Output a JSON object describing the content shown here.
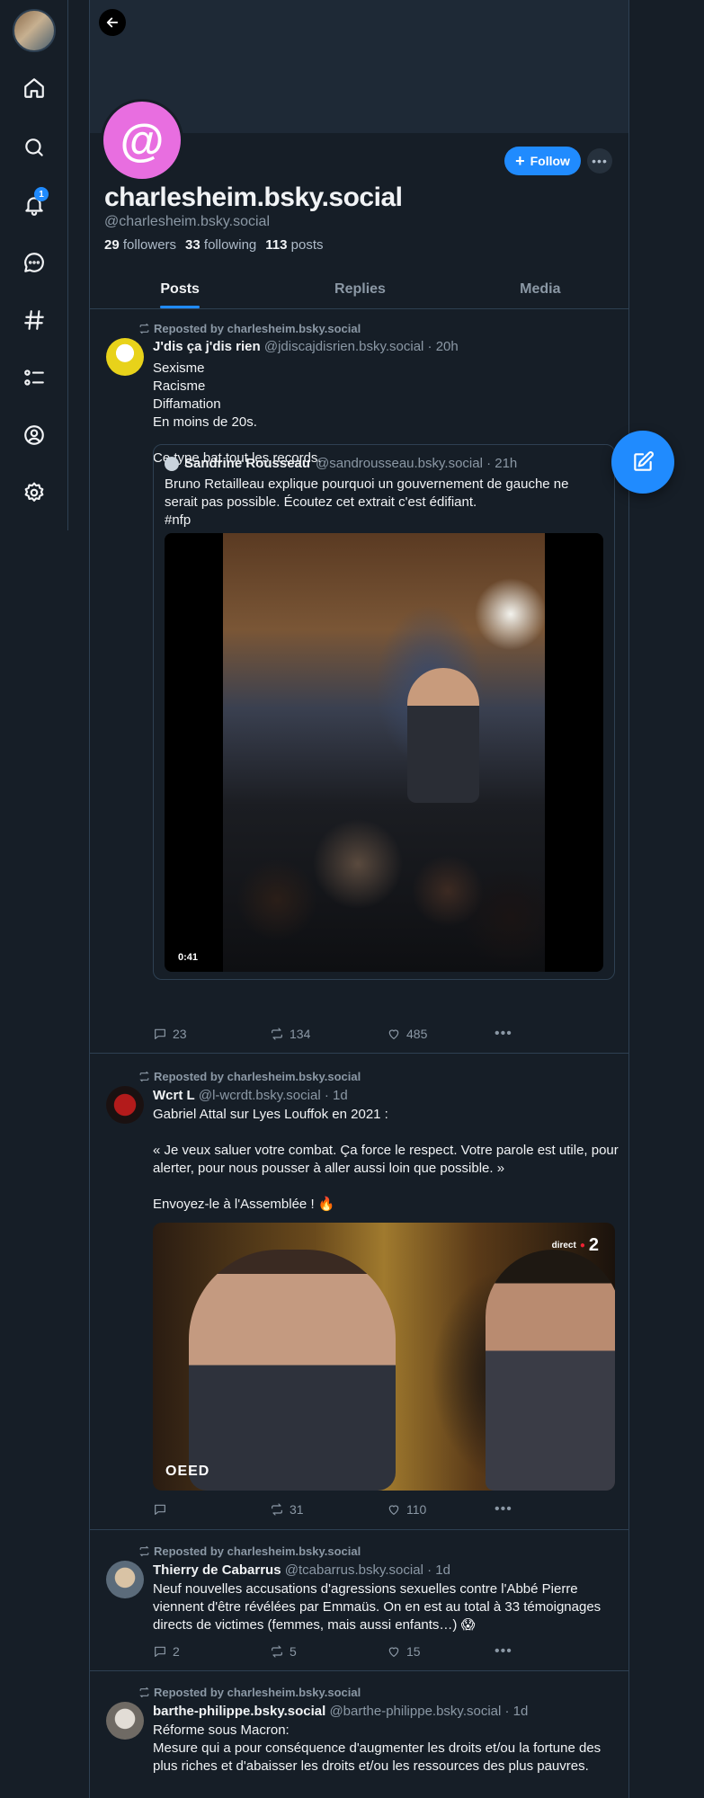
{
  "rail": {
    "notification_count": "1",
    "items": [
      {
        "name": "home-icon"
      },
      {
        "name": "search-icon"
      },
      {
        "name": "bell-icon"
      },
      {
        "name": "chat-icon"
      },
      {
        "name": "hashtag-icon"
      },
      {
        "name": "lists-icon"
      },
      {
        "name": "profile-icon"
      },
      {
        "name": "settings-icon"
      }
    ]
  },
  "profile": {
    "avatar_symbol": "@",
    "display_name": "charlesheim.bsky.social",
    "handle": "@charlesheim.bsky.social",
    "followers_count": "29",
    "followers_label": "followers",
    "following_count": "33",
    "following_label": "following",
    "posts_count": "113",
    "posts_label": "posts",
    "follow_label": "Follow"
  },
  "tabs": [
    {
      "label": "Posts",
      "active": true
    },
    {
      "label": "Replies",
      "active": false
    },
    {
      "label": "Media",
      "active": false
    }
  ],
  "posts": [
    {
      "repost_label": "Reposted by charlesheim.bsky.social",
      "author": "J'dis ça j'dis rien",
      "meta": "@jdiscajdisrien.bsky.social · 20h",
      "text": "Sexisme\nRacisme\nDiffamation\nEn moins de 20s.\n\nCe type bat tout les records.",
      "quote": {
        "author": "Sandrine Rousseau",
        "meta": "@sandrousseau.bsky.social · 21h",
        "text": "Bruno Retailleau explique pourquoi un gouvernement de gauche ne serait pas possible. Écoutez cet extrait c'est édifiant.\n#nfp",
        "video_duration": "0:41"
      },
      "replies": "23",
      "reposts": "134",
      "likes": "485"
    },
    {
      "repost_label": "Reposted by charlesheim.bsky.social",
      "author": "Wcrt L",
      "meta": "@l-wcrdt.bsky.social · 1d",
      "text": "Gabriel Attal sur Lyes Louffok en 2021 :\n\n« Je veux saluer votre combat. Ça force le respect. Votre parole est utile, pour alerter, pour nous pousser à aller aussi loin que possible. »\n\nEnvoyez-le à l'Assemblée ! 🔥",
      "tv_logo_prefix": "direct",
      "tv_logo": "2",
      "tv_watermark": "OEED",
      "replies": "",
      "reposts": "31",
      "likes": "110"
    },
    {
      "repost_label": "Reposted by charlesheim.bsky.social",
      "author": "Thierry de Cabarrus",
      "meta": "@tcabarrus.bsky.social · 1d",
      "text": "Neuf nouvelles accusations d'agressions sexuelles contre l'Abbé Pierre viennent d'être révélées par Emmaüs. On en est au total à 33 témoignages directs de victimes (femmes, mais aussi enfants…) 😱",
      "replies": "2",
      "reposts": "5",
      "likes": "15"
    },
    {
      "repost_label": "Reposted by charlesheim.bsky.social",
      "author": "barthe-philippe.bsky.social",
      "meta": "@barthe-philippe.bsky.social · 1d",
      "text": "Réforme sous Macron:\nMesure qui a pour conséquence d'augmenter les droits et/ou la fortune des plus riches et d'abaisser les droits et/ou les ressources des plus pauvres."
    }
  ],
  "colors": {
    "background": "#161e27",
    "accent": "#208bfe",
    "avatar_pink": "#e86ee0",
    "border": "#2e4052",
    "muted_text": "#8b98a5"
  }
}
